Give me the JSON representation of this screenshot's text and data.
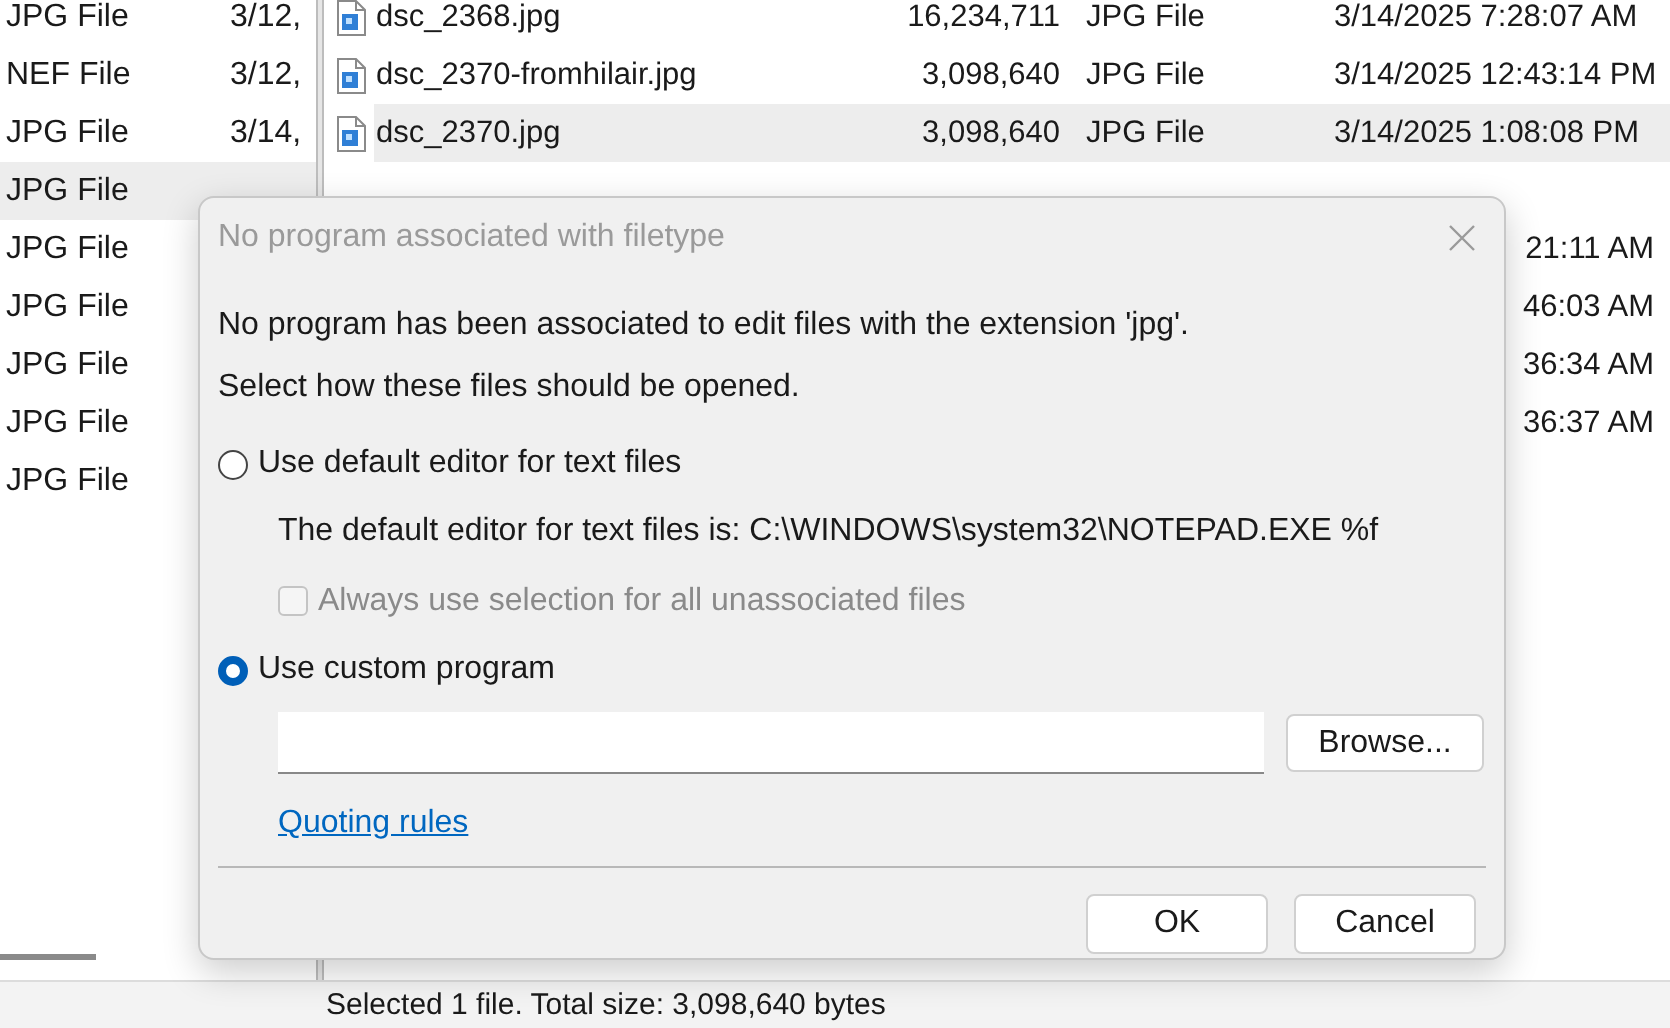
{
  "left_pane": {
    "rows": [
      {
        "type": "JPG File",
        "date": "3/12,",
        "selected": false
      },
      {
        "type": "NEF File",
        "date": "3/12,",
        "selected": false
      },
      {
        "type": "JPG File",
        "date": "3/14,",
        "selected": false
      },
      {
        "type": "JPG File",
        "selected": true
      },
      {
        "type": "JPG File",
        "selected": false
      },
      {
        "type": "JPG File",
        "selected": false
      },
      {
        "type": "JPG File",
        "selected": false
      },
      {
        "type": "JPG File",
        "selected": false
      },
      {
        "type": "JPG File",
        "selected": false
      }
    ]
  },
  "file_list": {
    "rows": [
      {
        "name": "dsc_2368.jpg",
        "size": "16,234,711",
        "type": "JPG File",
        "modified": "3/14/2025 7:28:07 AM",
        "selected": false
      },
      {
        "name": "dsc_2370-fromhilair.jpg",
        "size": "3,098,640",
        "type": "JPG File",
        "modified": "3/14/2025 12:43:14 PM",
        "selected": false
      },
      {
        "name": "dsc_2370.jpg",
        "size": "3,098,640",
        "type": "JPG File",
        "modified": "3/14/2025 1:08:08 PM",
        "selected": true
      },
      {
        "selected": false
      },
      {
        "modified": "21:11 AM",
        "selected": false
      },
      {
        "modified": "46:03 AM",
        "selected": false
      },
      {
        "modified": "36:34 AM",
        "selected": false
      },
      {
        "modified": "36:37 AM",
        "selected": false
      }
    ]
  },
  "status_bar": "Selected 1 file. Total size: 3,098,640 bytes",
  "dialog": {
    "title": "No program associated with filetype",
    "message": "No program has been associated to edit files with the extension 'jpg'.",
    "prompt": "Select how these files should be opened.",
    "options": [
      {
        "kind": "radio",
        "label": "Use default editor for text files",
        "selected": false
      },
      {
        "kind": "note",
        "text": "The default editor for text files is: C:\\WINDOWS\\system32\\NOTEPAD.EXE %f"
      },
      {
        "kind": "checkbox",
        "label": "Always use selection for all unassociated files",
        "checked": false,
        "disabled": true
      },
      {
        "kind": "radio",
        "label": "Use custom program",
        "selected": true
      }
    ],
    "browse_button": "Browse...",
    "link": "Quoting rules",
    "buttons": [
      "OK",
      "Cancel"
    ]
  }
}
